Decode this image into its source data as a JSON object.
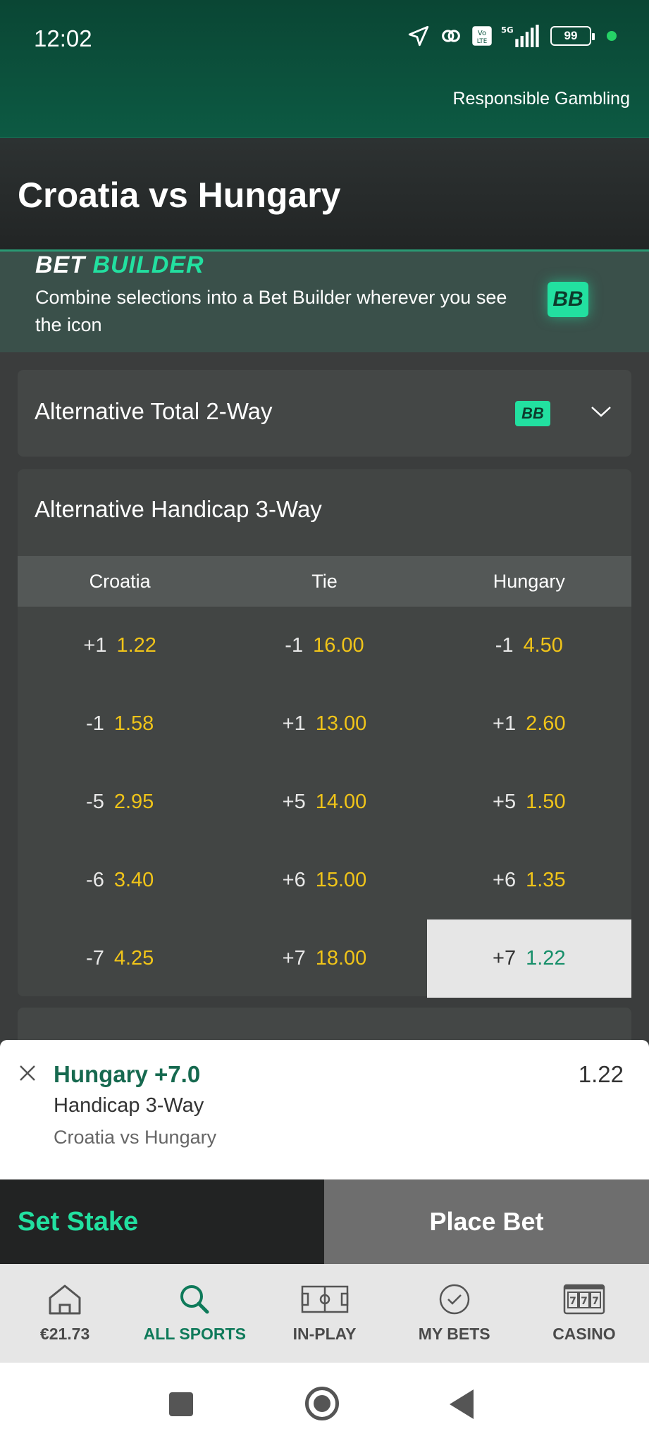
{
  "status_bar": {
    "time": "12:02",
    "battery": "99"
  },
  "top": {
    "responsible_label": "Responsible Gambling"
  },
  "event": {
    "title": "Croatia vs Hungary"
  },
  "bet_builder_banner": {
    "title_part1": "BET",
    "title_part2": "BUILDER",
    "text": "Combine selections into a Bet Builder wherever you see the icon",
    "badge": "BB"
  },
  "markets": [
    {
      "label": "Alternative Total 2-Way",
      "badge": "BB"
    },
    {
      "label": "Alternative Handicap 3-Way",
      "columns": [
        "Croatia",
        "Tie",
        "Hungary"
      ],
      "rows": [
        [
          {
            "line": "+1",
            "odds": "1.22"
          },
          {
            "line": "-1",
            "odds": "16.00"
          },
          {
            "line": "-1",
            "odds": "4.50"
          }
        ],
        [
          {
            "line": "-1",
            "odds": "1.58"
          },
          {
            "line": "+1",
            "odds": "13.00"
          },
          {
            "line": "+1",
            "odds": "2.60"
          }
        ],
        [
          {
            "line": "-5",
            "odds": "2.95"
          },
          {
            "line": "+5",
            "odds": "14.00"
          },
          {
            "line": "+5",
            "odds": "1.50"
          }
        ],
        [
          {
            "line": "-6",
            "odds": "3.40"
          },
          {
            "line": "+6",
            "odds": "15.00"
          },
          {
            "line": "+6",
            "odds": "1.35"
          }
        ],
        [
          {
            "line": "-7",
            "odds": "4.25"
          },
          {
            "line": "+7",
            "odds": "18.00"
          },
          {
            "line": "+7",
            "odds": "1.22"
          }
        ]
      ],
      "selected": {
        "row": 4,
        "col": 2
      }
    }
  ],
  "betslip": {
    "selection": "Hungary +7.0",
    "market": "Handicap 3-Way",
    "event": "Croatia vs Hungary",
    "odds": "1.22"
  },
  "actions": {
    "set_stake": "Set Stake",
    "place_bet": "Place Bet"
  },
  "bottom_nav": [
    {
      "label": "€21.73",
      "icon": "home-icon"
    },
    {
      "label": "ALL SPORTS",
      "icon": "search-icon",
      "active": true
    },
    {
      "label": "IN-PLAY",
      "icon": "pitch-icon"
    },
    {
      "label": "MY BETS",
      "icon": "check-circle-icon"
    },
    {
      "label": "CASINO",
      "icon": "slot-machine-icon"
    }
  ],
  "colors": {
    "accent": "#22e0a0",
    "brand_dark": "#0d5540",
    "odds": "#f0c419"
  }
}
